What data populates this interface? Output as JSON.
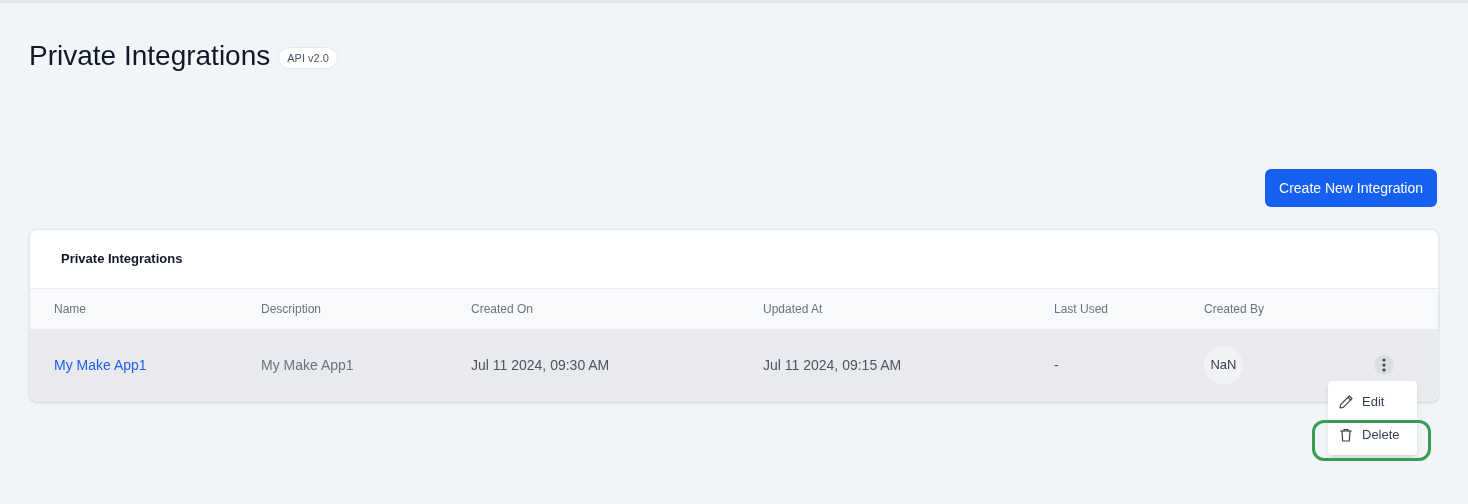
{
  "page": {
    "title": "Private Integrations",
    "badge": "API v2.0"
  },
  "create_button": "Create New Integration",
  "table": {
    "title": "Private Integrations",
    "columns": [
      "Name",
      "Description",
      "Created On",
      "Updated At",
      "Last Used",
      "Created By"
    ],
    "rows": [
      {
        "name": "My Make App1",
        "description": "My Make App1",
        "created_on": "Jul 11 2024, 09:30 AM",
        "updated_at": "Jul 11 2024, 09:15 AM",
        "last_used": "-",
        "created_by": "NaN",
        "selected": true
      }
    ]
  },
  "row_menu": {
    "items": [
      {
        "kind": "edit",
        "label": "Edit",
        "highlighted": false
      },
      {
        "kind": "delete",
        "label": "Delete",
        "highlighted": true
      }
    ]
  }
}
